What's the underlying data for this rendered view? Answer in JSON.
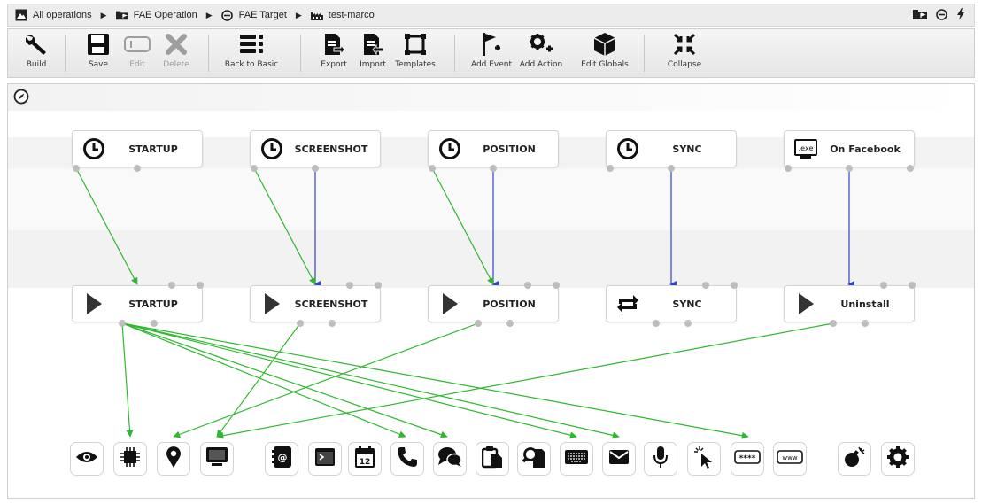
{
  "breadcrumb": {
    "items": [
      {
        "label": "All operations",
        "icon": "mountain-square-icon"
      },
      {
        "label": "FAE Operation",
        "icon": "folder-flag-icon"
      },
      {
        "label": "FAE Target",
        "icon": "crosshair-icon"
      },
      {
        "label": "test-marco",
        "icon": "factory-icon"
      }
    ],
    "separator": "▶",
    "right_icons": [
      "folder-flag-icon",
      "crosshair-icon",
      "bolt-icon"
    ]
  },
  "toolbar": {
    "build": "Build",
    "save": "Save",
    "edit": "Edit",
    "delete": "Delete",
    "back_to_basic": "Back to Basic",
    "export": "Export",
    "import": "Import",
    "templates": "Templates",
    "add_event": "Add Event",
    "add_action": "Add Action",
    "edit_globals": "Edit Globals",
    "collapse": "Collapse"
  },
  "events": [
    {
      "label": "STARTUP",
      "icon": "clock-icon"
    },
    {
      "label": "SCREENSHOT",
      "icon": "clock-icon"
    },
    {
      "label": "POSITION",
      "icon": "clock-icon"
    },
    {
      "label": "SYNC",
      "icon": "clock-icon"
    },
    {
      "label": "On Facebook",
      "icon": "exe-window-icon",
      "icon_text": ".exe"
    }
  ],
  "actions": [
    {
      "label": "STARTUP",
      "icon": "play-icon"
    },
    {
      "label": "SCREENSHOT",
      "icon": "play-icon"
    },
    {
      "label": "POSITION",
      "icon": "play-icon"
    },
    {
      "label": "SYNC",
      "icon": "sync-icon"
    },
    {
      "label": "Uninstall",
      "icon": "play-icon"
    }
  ],
  "modules": [
    {
      "name": "eye-icon"
    },
    {
      "name": "chip-icon"
    },
    {
      "name": "map-pin-icon"
    },
    {
      "name": "monitor-icon"
    },
    {
      "name": "address-book-icon",
      "text": "@"
    },
    {
      "name": "terminal-icon"
    },
    {
      "name": "calendar-icon",
      "text": "12"
    },
    {
      "name": "phone-icon"
    },
    {
      "name": "chat-icon"
    },
    {
      "name": "clipboard-icon"
    },
    {
      "name": "file-search-icon"
    },
    {
      "name": "keyboard-icon"
    },
    {
      "name": "mail-icon"
    },
    {
      "name": "microphone-icon"
    },
    {
      "name": "cursor-click-icon"
    },
    {
      "name": "password-icon",
      "text": "****"
    },
    {
      "name": "www-icon",
      "text": "www"
    },
    {
      "name": "bomb-icon"
    },
    {
      "name": "gear-icon"
    }
  ],
  "colors": {
    "event_link": "#2f47c8",
    "action_link": "#2eb82e",
    "port": "#bdbdbd"
  }
}
